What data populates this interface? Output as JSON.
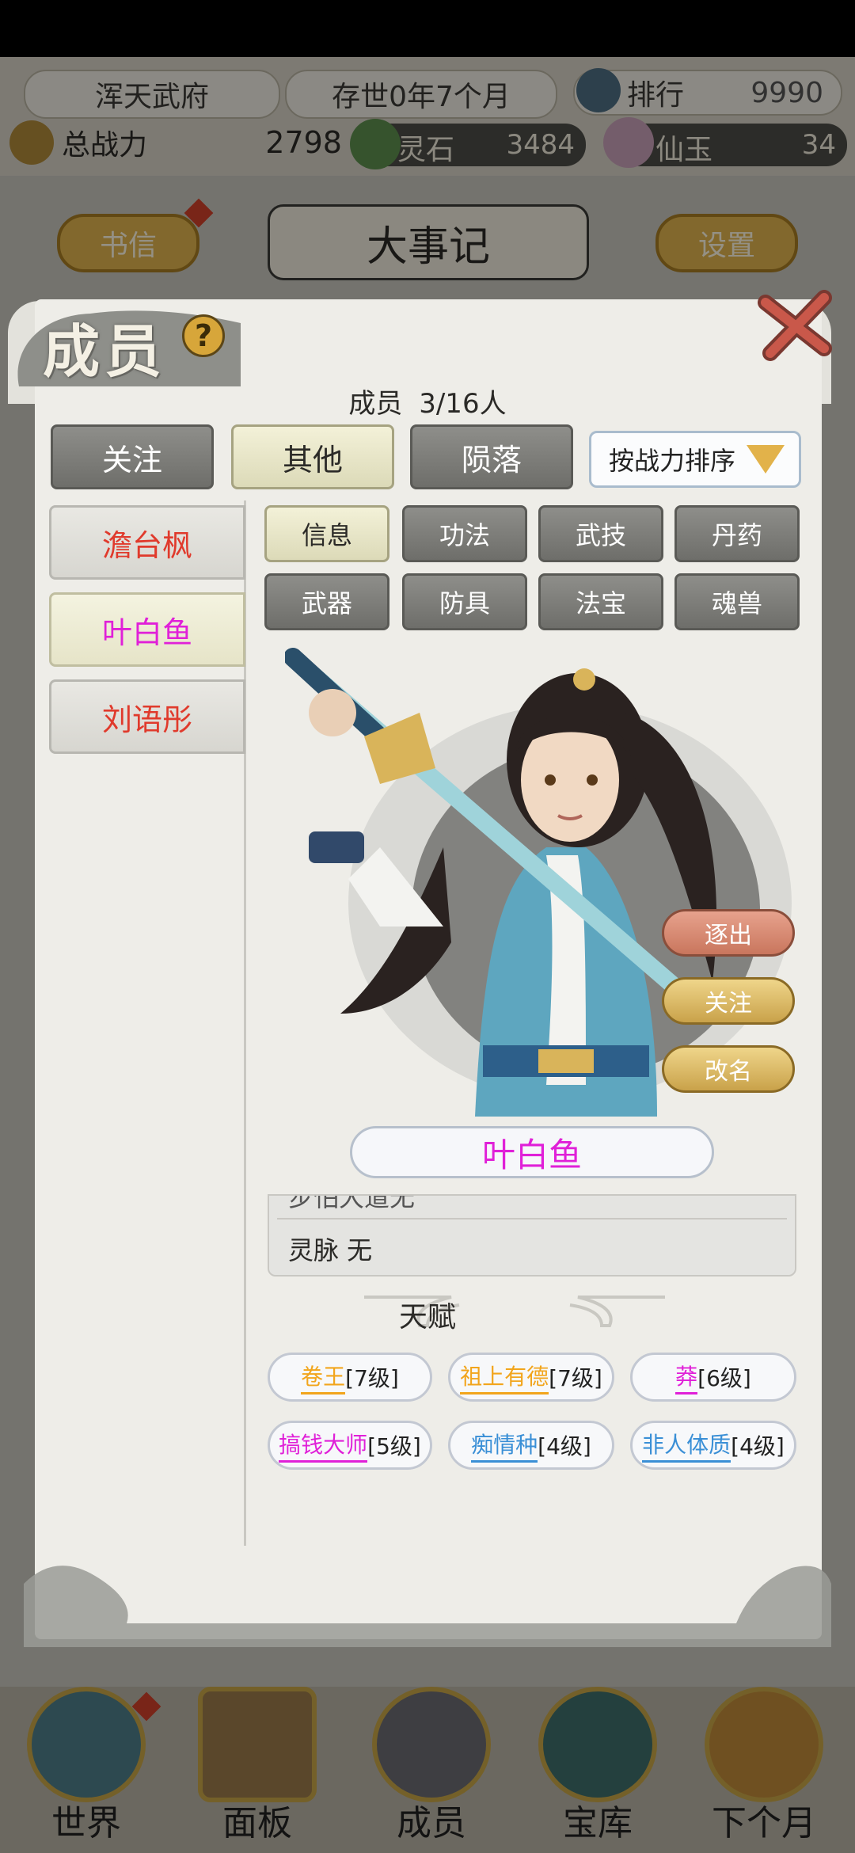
{
  "topbar": {
    "sect_name": "浑天武府",
    "time": "存世0年7个月",
    "rank_label": "排行",
    "rank_value": "9990",
    "power_label": "总战力",
    "power_value": "2798",
    "spirit_stone_label": "灵石",
    "spirit_stone_value": "3484",
    "jade_label": "仙玉",
    "jade_value": "34"
  },
  "background_buttons": {
    "letters": "书信",
    "chronicle": "大事记",
    "settings": "设置"
  },
  "panel": {
    "title": "成员",
    "help_glyph": "?",
    "member_count_label": "成员",
    "member_count_value": "3/16人",
    "filter_tabs": [
      "关注",
      "其他",
      "陨落"
    ],
    "selected_filter": "其他",
    "sort_label": "按战力排序"
  },
  "members": [
    {
      "name": "澹台枫",
      "color": "#e03a2c"
    },
    {
      "name": "叶白鱼",
      "color": "#e020d8"
    },
    {
      "name": "刘语彤",
      "color": "#e03a2c"
    }
  ],
  "selected_member": "叶白鱼",
  "detail_tabs": [
    "信息",
    "功法",
    "武技",
    "丹药",
    "武器",
    "防具",
    "法宝",
    "魂兽"
  ],
  "selected_detail_tab": "信息",
  "actions": {
    "expel": "逐出",
    "follow": "关注",
    "rename": "改名"
  },
  "character": {
    "name": "叶白鱼",
    "name_color": "#e020d8",
    "info_partial": "步怕大道无",
    "spirit_vein": "灵脉 无"
  },
  "talents_title": "天赋",
  "talents": [
    {
      "name": "卷王",
      "level": "[7级]",
      "color": "#f2a51c"
    },
    {
      "name": "祖上有德",
      "level": "[7级]",
      "color": "#f2a51c"
    },
    {
      "name": "莽",
      "level": "[6级]",
      "color": "#e020d8"
    },
    {
      "name": "搞钱大师",
      "level": "[5级]",
      "color": "#e020d8"
    },
    {
      "name": "痴情种",
      "level": "[4级]",
      "color": "#3a8fd6"
    },
    {
      "name": "非人体质",
      "level": "[4级]",
      "color": "#3a8fd6"
    }
  ],
  "nav": {
    "world": "世界",
    "panel": "面板",
    "members": "成员",
    "treasury": "宝库",
    "next_month": "下个月"
  }
}
